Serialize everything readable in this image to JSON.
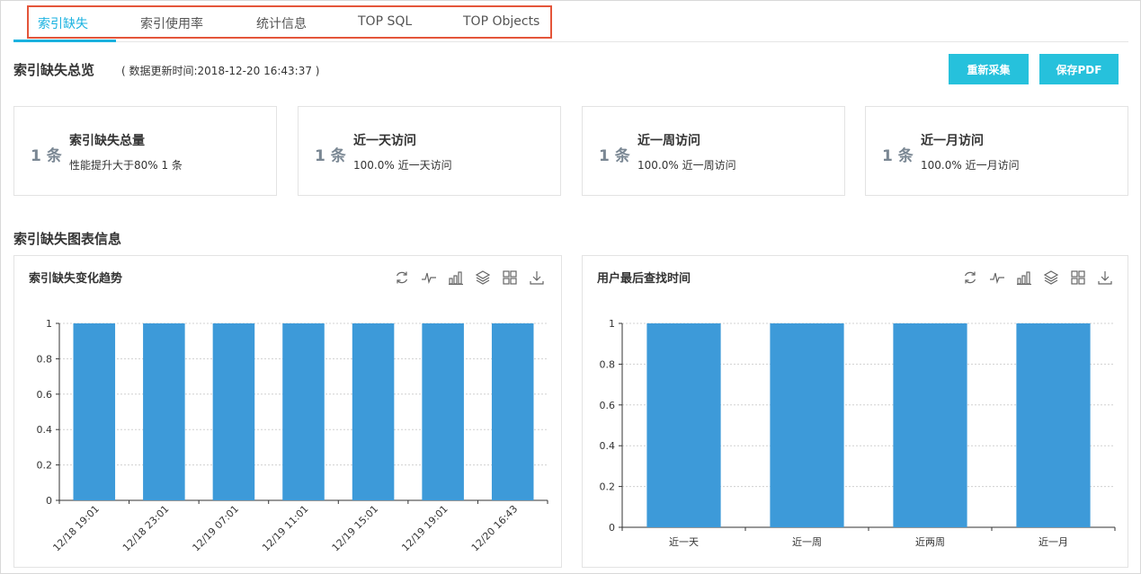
{
  "tabs": [
    {
      "label": "索引缺失",
      "active": true
    },
    {
      "label": "索引使用率",
      "active": false
    },
    {
      "label": "统计信息",
      "active": false
    },
    {
      "label": "TOP SQL",
      "active": false
    },
    {
      "label": "TOP Objects",
      "active": false
    }
  ],
  "overview": {
    "title": "索引缺失总览",
    "update_time": "( 数据更新时间:2018-12-20 16:43:37 )",
    "recollect_label": "重新采集",
    "save_pdf_label": "保存PDF"
  },
  "cards": [
    {
      "count": "1 条",
      "title": "索引缺失总量",
      "sub": "性能提升大于80% 1 条"
    },
    {
      "count": "1 条",
      "title": "近一天访问",
      "sub": "100.0% 近一天访问"
    },
    {
      "count": "1 条",
      "title": "近一周访问",
      "sub": "100.0% 近一周访问"
    },
    {
      "count": "1 条",
      "title": "近一月访问",
      "sub": "100.0% 近一月访问"
    }
  ],
  "charts_section_title": "索引缺失图表信息",
  "toolbar_icons": [
    "refresh-icon",
    "line-chart-icon",
    "bar-chart-icon",
    "stack-icon",
    "grid-icon",
    "download-icon"
  ],
  "colors": {
    "accent": "#1ab2e0",
    "button": "#26c1dc",
    "bar": "#3d9ad9",
    "highlight_border": "#e4553a"
  },
  "chart_data": [
    {
      "type": "bar",
      "title": "索引缺失变化趋势",
      "categories": [
        "12/18 19:01",
        "12/18 23:01",
        "12/19 07:01",
        "12/19 11:01",
        "12/19 15:01",
        "12/19 19:01",
        "12/20 16:43"
      ],
      "values": [
        1,
        1,
        1,
        1,
        1,
        1,
        1
      ],
      "yticks": [
        "0",
        "0.2",
        "0.4",
        "0.6",
        "0.8",
        "1"
      ],
      "ylim": [
        0,
        1
      ],
      "grid": true
    },
    {
      "type": "bar",
      "title": "用户最后查找时间",
      "categories": [
        "近一天",
        "近一周",
        "近两周",
        "近一月"
      ],
      "values": [
        1,
        1,
        1,
        1
      ],
      "yticks": [
        "0",
        "0.2",
        "0.4",
        "0.6",
        "0.8",
        "1"
      ],
      "ylim": [
        0,
        1
      ],
      "grid": true
    }
  ]
}
